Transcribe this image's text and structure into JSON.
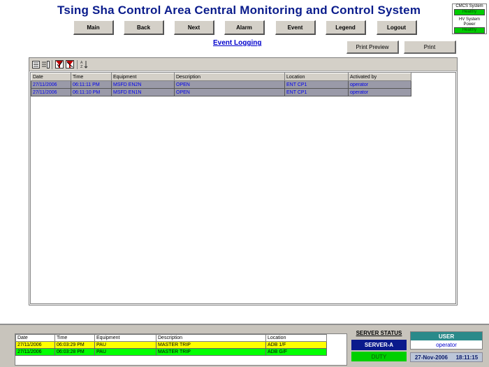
{
  "app": {
    "title": "Tsing Sha Control Area Central Monitoring and Control System"
  },
  "system_status": [
    {
      "label": "CMCS System",
      "status": "Healthy"
    },
    {
      "label": "HV System Power",
      "status": "Healthy"
    }
  ],
  "nav": {
    "main": "Main",
    "back": "Back",
    "next": "Next",
    "alarm": "Alarm",
    "event": "Event",
    "legend": "Legend",
    "logout": "Logout"
  },
  "page": {
    "title": "Event Logging",
    "print_preview": "Print Preview",
    "print": "Print"
  },
  "toolbar": {
    "icons": [
      "list-view-icon",
      "details-view-icon",
      "filter-check-icon",
      "filter-clear-icon",
      "sort-icon"
    ]
  },
  "event_table": {
    "columns": [
      "Date",
      "Time",
      "Equipment",
      "Description",
      "Location",
      "Activated by"
    ],
    "rows": [
      [
        "27/11/2006",
        "06:11:11 PM",
        "MSFD EN2N",
        "OPEN",
        "ENT CP1",
        "operator"
      ],
      [
        "27/11/2006",
        "06:11:10 PM",
        "MSFD EN1N",
        "OPEN",
        "ENT CP1",
        "operator"
      ]
    ]
  },
  "alarm_table": {
    "columns": [
      "Date",
      "Time",
      "Equipment",
      "Description",
      "Location"
    ],
    "rows": [
      {
        "cells": [
          "27/11/2006",
          "06:03:29 PM",
          "PAU",
          "MASTER TRIP",
          "ADB 1/F"
        ],
        "color": "#ffff00"
      },
      {
        "cells": [
          "27/11/2006",
          "06:03:28 PM",
          "PAU",
          "MASTER TRIP",
          "ADB G/F"
        ],
        "color": "#00ff00"
      }
    ]
  },
  "server": {
    "title": "SERVER STATUS",
    "name": "SERVER-A",
    "state": "DUTY"
  },
  "user": {
    "title": "USER",
    "name": "operator"
  },
  "clock": {
    "date": "27-Nov-2006",
    "time": "18:11:15"
  },
  "colors": {
    "title": "#0a1c8c",
    "healthy": "#00cc00",
    "server_bg": "#0a1a8c",
    "duty_bg": "#00d000",
    "user_title_bg": "#2a8a8a"
  }
}
